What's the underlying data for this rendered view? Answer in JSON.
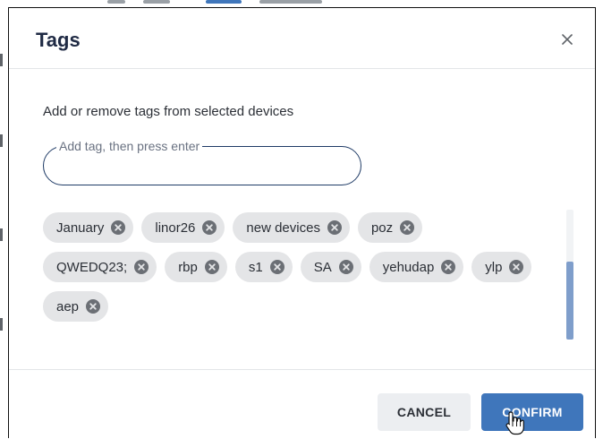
{
  "dialog": {
    "title": "Tags",
    "close_icon": "close-icon",
    "description": "Add or remove tags from selected devices"
  },
  "tag_input": {
    "label": "Add tag, then press enter",
    "value": ""
  },
  "tags": [
    {
      "label": "January"
    },
    {
      "label": "linor26"
    },
    {
      "label": "new devices"
    },
    {
      "label": "poz"
    },
    {
      "label": "QWEDQ23;"
    },
    {
      "label": "rbp"
    },
    {
      "label": "s1"
    },
    {
      "label": "SA"
    },
    {
      "label": "yehudap"
    },
    {
      "label": "ylp"
    },
    {
      "label": "aep"
    }
  ],
  "tag_remove_icon": "remove-circle-icon",
  "footer": {
    "cancel_label": "CANCEL",
    "confirm_label": "CONFIRM"
  },
  "colors": {
    "title": "#1f2a44",
    "chip_background": "#e4e5e7",
    "confirm_button": "#3f76bb",
    "cancel_button": "#eceef1",
    "input_border": "#1f3b66",
    "scroll_thumb": "#7f9ecb"
  },
  "cursor_icon": "hand-pointer-icon"
}
